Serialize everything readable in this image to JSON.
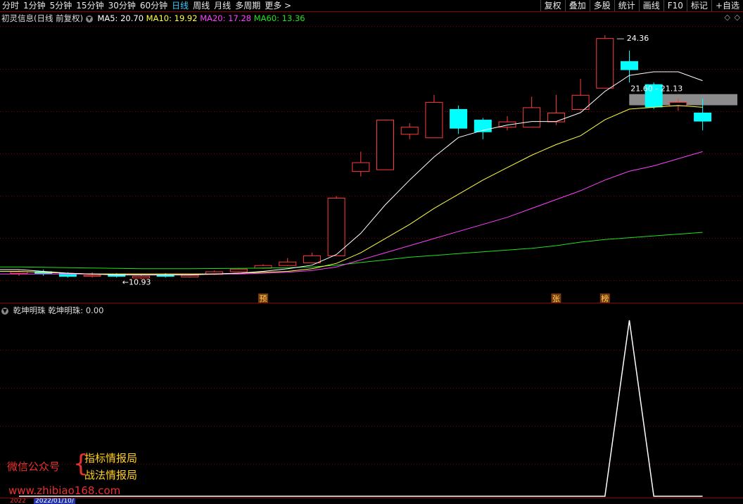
{
  "toolbar": {
    "periods": [
      "分时",
      "1分钟",
      "5分钟",
      "15分钟",
      "30分钟",
      "60分钟",
      "日线",
      "周线",
      "月线",
      "多周期",
      "更多 >"
    ],
    "active_period": "日线",
    "tools": [
      "复权",
      "叠加",
      "多股",
      "统计",
      "画线",
      "F10",
      "标记",
      "+自选"
    ]
  },
  "header": {
    "stock_title": "初灵信息(日线 前复权)",
    "ma5": "MA5: 20.70",
    "ma10": "MA10: 19.92",
    "ma20": "MA20: 17.28",
    "ma60": "MA60: 13.36"
  },
  "colors": {
    "up": "#ff3c3c",
    "down": "#00ffff",
    "ma5": "#ffffff",
    "ma10": "#ffff40",
    "ma20": "#ff40ff",
    "ma60": "#20e020",
    "grid": "#8b0000",
    "resistance_band": "#8c8c8c"
  },
  "annotations": {
    "high_label": "24.36",
    "low_label": "10.93",
    "range_label": "21.60 - 21.13",
    "markers": [
      "预",
      "张",
      "榜"
    ]
  },
  "indicator": {
    "title": "乾坤明珠",
    "value_label": "乾坤明珠: 0.00"
  },
  "watermark": {
    "label": "微信公众号",
    "line1": "指标情报局",
    "line2": "战法情报局",
    "url": "www.zhibiao168.com"
  },
  "date_bar": {
    "left_text": "2022",
    "date_text": "2022/01/10/"
  },
  "chart_data": {
    "type": "candlestick",
    "price_range": [
      10,
      25
    ],
    "candles": [
      {
        "o": 10.95,
        "h": 11.1,
        "l": 10.8,
        "c": 11.05
      },
      {
        "o": 11.05,
        "h": 11.15,
        "l": 10.8,
        "c": 10.9
      },
      {
        "o": 10.95,
        "h": 11.0,
        "l": 10.7,
        "c": 10.75
      },
      {
        "o": 10.8,
        "h": 11.0,
        "l": 10.7,
        "c": 10.85
      },
      {
        "o": 10.9,
        "h": 10.95,
        "l": 10.7,
        "c": 10.75
      },
      {
        "o": 10.7,
        "h": 10.85,
        "l": 10.6,
        "c": 10.8
      },
      {
        "o": 10.85,
        "h": 10.95,
        "l": 10.7,
        "c": 10.75
      },
      {
        "o": 10.75,
        "h": 10.9,
        "l": 10.7,
        "c": 10.85
      },
      {
        "o": 10.9,
        "h": 11.1,
        "l": 10.85,
        "c": 11.05
      },
      {
        "o": 11.05,
        "h": 11.25,
        "l": 11.0,
        "c": 11.2
      },
      {
        "o": 11.25,
        "h": 11.45,
        "l": 11.2,
        "c": 11.4
      },
      {
        "o": 11.4,
        "h": 11.8,
        "l": 11.35,
        "c": 11.6
      },
      {
        "o": 11.55,
        "h": 12.1,
        "l": 11.5,
        "c": 11.95
      },
      {
        "o": 11.95,
        "h": 15.3,
        "l": 11.95,
        "c": 15.2
      },
      {
        "o": 16.7,
        "h": 17.8,
        "l": 16.4,
        "c": 17.2
      },
      {
        "o": 16.8,
        "h": 19.6,
        "l": 16.8,
        "c": 19.6
      },
      {
        "o": 18.8,
        "h": 19.4,
        "l": 18.5,
        "c": 19.2
      },
      {
        "o": 18.6,
        "h": 21.0,
        "l": 18.6,
        "c": 20.6
      },
      {
        "o": 20.2,
        "h": 20.4,
        "l": 18.8,
        "c": 19.1
      },
      {
        "o": 19.6,
        "h": 19.7,
        "l": 18.5,
        "c": 18.9
      },
      {
        "o": 19.2,
        "h": 19.8,
        "l": 19.0,
        "c": 19.5
      },
      {
        "o": 19.2,
        "h": 20.9,
        "l": 19.2,
        "c": 20.3
      },
      {
        "o": 19.5,
        "h": 21.0,
        "l": 19.3,
        "c": 20.0
      },
      {
        "o": 20.2,
        "h": 21.9,
        "l": 20.1,
        "c": 21.0
      },
      {
        "o": 21.4,
        "h": 24.36,
        "l": 21.4,
        "c": 24.2
      },
      {
        "o": 22.9,
        "h": 23.5,
        "l": 21.7,
        "c": 22.4
      },
      {
        "o": 21.6,
        "h": 21.7,
        "l": 20.2,
        "c": 20.3
      },
      {
        "o": 20.4,
        "h": 20.8,
        "l": 20.1,
        "c": 20.6
      },
      {
        "o": 20.0,
        "h": 20.8,
        "l": 19.0,
        "c": 19.5
      }
    ],
    "ma5": [
      11.15,
      11.05,
      10.95,
      10.9,
      10.85,
      10.85,
      10.85,
      10.85,
      10.9,
      10.95,
      11.05,
      11.2,
      11.4,
      12.0,
      13.2,
      14.8,
      16.2,
      17.5,
      18.6,
      19.0,
      19.3,
      19.5,
      19.5,
      20.0,
      21.2,
      22.1,
      22.3,
      22.3,
      21.8
    ],
    "ma10": [
      11.05,
      11.0,
      10.95,
      10.9,
      10.9,
      10.9,
      10.9,
      10.9,
      10.9,
      10.95,
      11.0,
      11.05,
      11.2,
      11.5,
      12.1,
      12.9,
      13.7,
      14.6,
      15.4,
      16.2,
      16.9,
      17.6,
      18.2,
      18.7,
      19.6,
      20.2,
      20.3,
      20.4,
      20.3
    ],
    "ma20": [
      10.9,
      10.9,
      10.9,
      10.9,
      10.9,
      10.9,
      10.9,
      10.9,
      10.9,
      10.9,
      10.95,
      11.0,
      11.1,
      11.3,
      11.7,
      12.1,
      12.5,
      12.9,
      13.3,
      13.7,
      14.1,
      14.6,
      15.1,
      15.6,
      16.2,
      16.7,
      17.0,
      17.4,
      17.8
    ],
    "ma60": [
      11.3,
      11.28,
      11.26,
      11.24,
      11.22,
      11.2,
      11.2,
      11.2,
      11.21,
      11.22,
      11.24,
      11.26,
      11.3,
      11.4,
      11.55,
      11.7,
      11.85,
      11.95,
      12.05,
      12.15,
      12.25,
      12.35,
      12.5,
      12.7,
      12.85,
      12.95,
      13.05,
      13.15,
      13.25
    ],
    "indicator_range": [
      0,
      1
    ],
    "indicator_values": [
      0,
      0,
      0,
      0,
      0,
      0,
      0,
      0,
      0,
      0,
      0,
      0,
      0,
      0,
      0,
      0,
      0,
      0,
      0,
      0,
      0,
      0,
      0,
      0,
      0,
      1,
      0,
      0,
      0
    ],
    "resistance": {
      "from": 21.13,
      "to": 21.6,
      "start_index": 24
    }
  }
}
